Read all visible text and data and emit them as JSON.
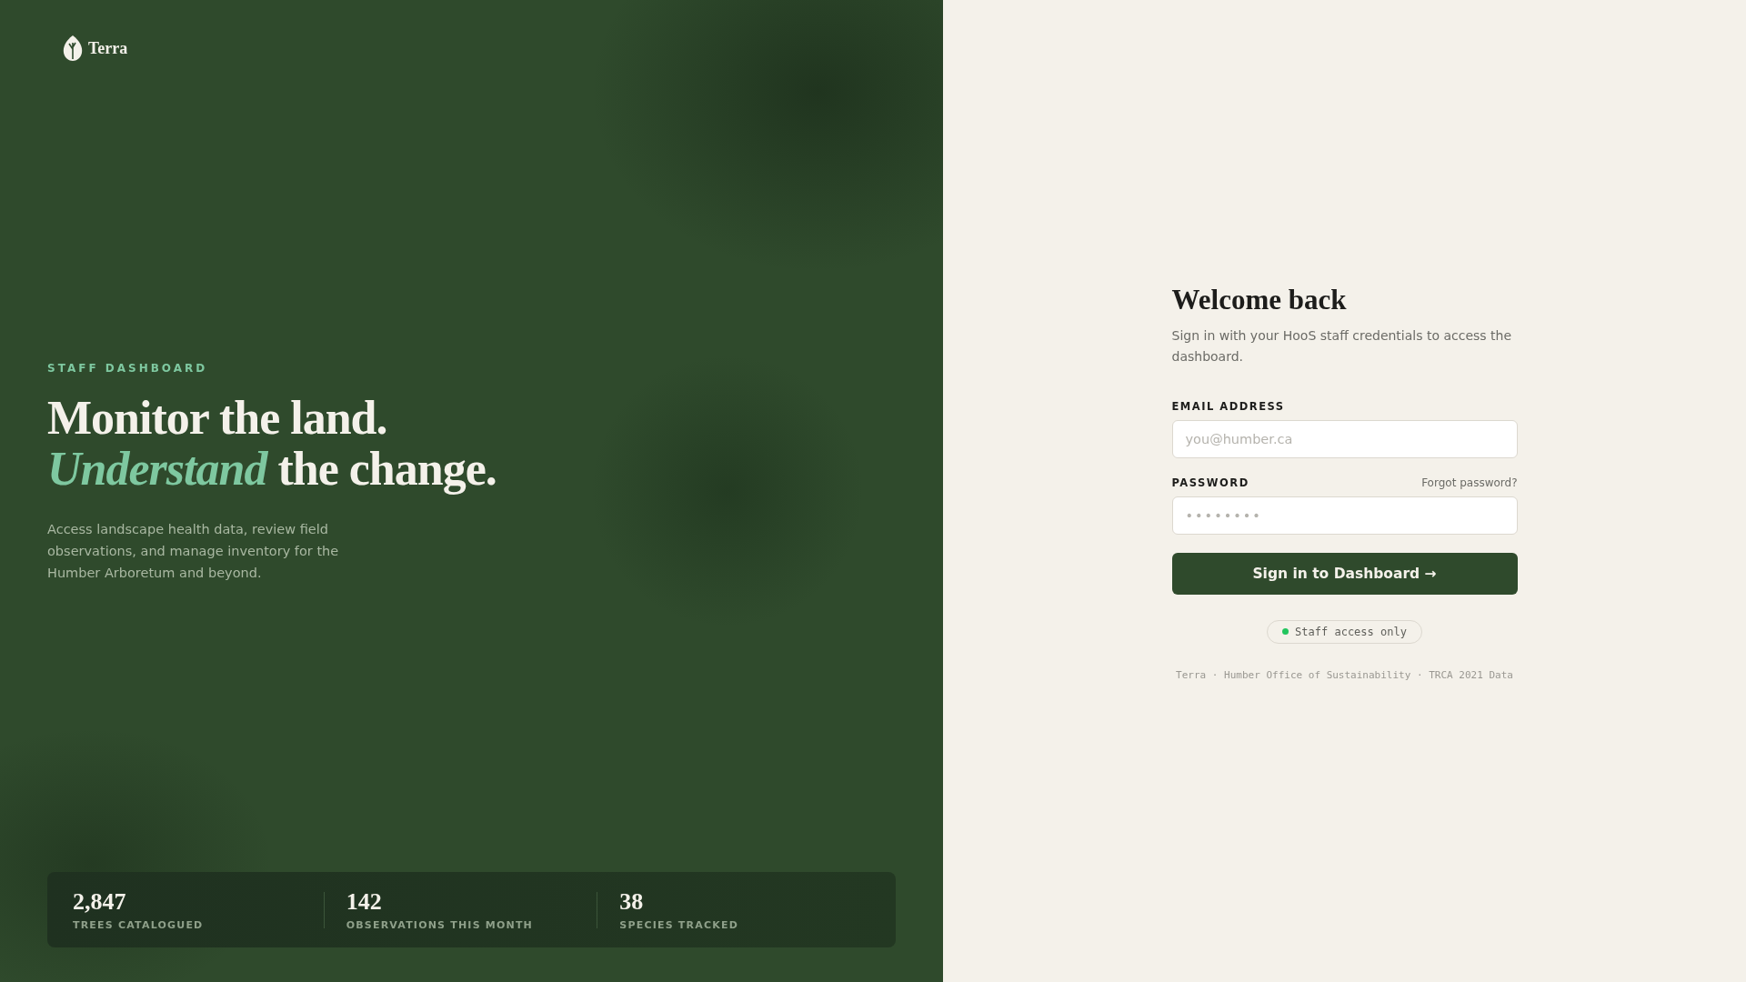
{
  "brand": {
    "name": "Terra"
  },
  "hero": {
    "eyebrow": "STAFF DASHBOARD",
    "headline_lines": [
      "Monitor the land.",
      "*Understand* the change."
    ],
    "description": "Access landscape health data, review field observations, and manage inventory for the Humber Arboretum and beyond."
  },
  "stats": [
    {
      "value": "2,847",
      "label": "TREES CATALOGUED"
    },
    {
      "value": "142",
      "label": "OBSERVATIONS THIS MONTH"
    },
    {
      "value": "38",
      "label": "SPECIES TRACKED"
    }
  ],
  "login": {
    "title": "Welcome back",
    "subtitle": "Sign in with your HooS staff credentials to access the dashboard.",
    "email": {
      "label": "EMAIL ADDRESS",
      "placeholder": "you@humber.ca"
    },
    "password": {
      "label": "PASSWORD",
      "placeholder": "••••••••",
      "forgot_link": "Forgot password?"
    },
    "submit": "Sign in to Dashboard →",
    "access_badge": {
      "text": "Staff access only",
      "color": "#22c55e"
    },
    "footer": "Terra · Humber Office of Sustainability · TRCA 2021 Data"
  }
}
